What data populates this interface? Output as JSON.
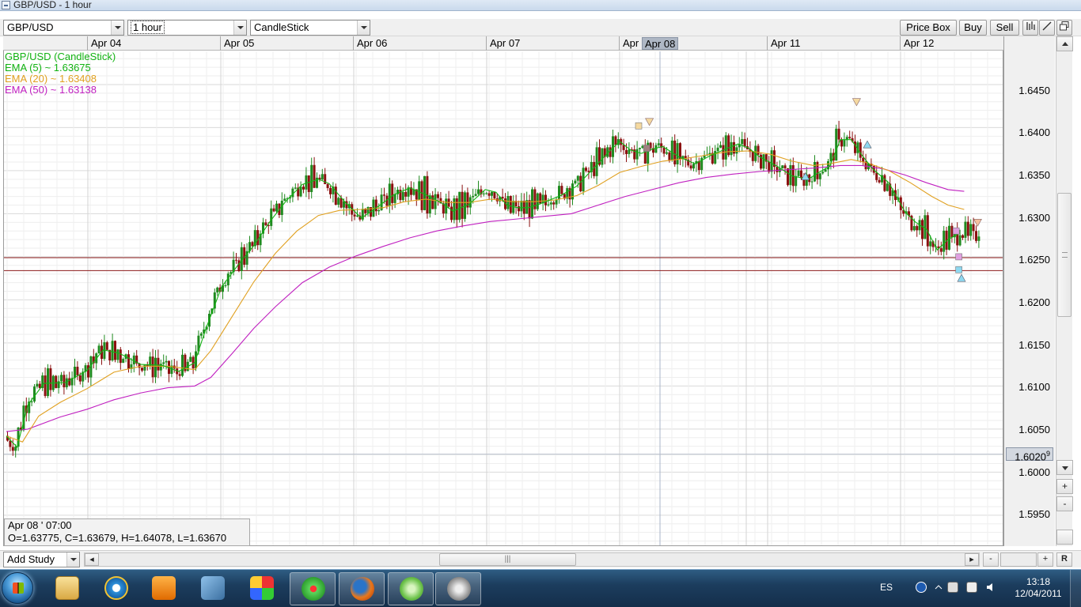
{
  "window": {
    "title": "GBP/USD - 1 hour"
  },
  "toolbar": {
    "symbol": "GBP/USD",
    "timeframe": "1 hour",
    "chart_type": "CandleStick",
    "buttons": {
      "price_box": "Price Box",
      "buy": "Buy",
      "sell": "Sell"
    }
  },
  "legend": {
    "main": "GBP/USD (CandleStick)",
    "ema5": "EMA (5) ~ 1.63675",
    "ema20": "EMA (20) ~ 1.63408",
    "ema50": "EMA (50) ~ 1.63138"
  },
  "x_axis": {
    "labels": [
      "Apr 04",
      "Apr 05",
      "Apr 06",
      "Apr 07",
      "Apr",
      "Apr 11",
      "Apr 12"
    ],
    "cursor_label": "Apr 08"
  },
  "y_axis": {
    "labels": [
      "1.6450",
      "1.6400",
      "1.6350",
      "1.6300",
      "1.6250",
      "1.6200",
      "1.6150",
      "1.6100",
      "1.6050",
      "1.6000",
      "1.5950"
    ],
    "cursor_value": "1.6020",
    "cursor_superscript": "9"
  },
  "info_box": {
    "line1": "Apr 08 ' 07:00",
    "line2": "O=1.63775, C=1.63679, H=1.64078, L=1.63670"
  },
  "bottom": {
    "add_study": "Add Study",
    "r_label": "R",
    "plus": "+",
    "minus": "-"
  },
  "tray": {
    "language": "ES",
    "time": "13:18",
    "date": "12/04/2011"
  },
  "colors": {
    "up_candle": "#1f8a1f",
    "down_candle": "#8b1010",
    "ema5": "#13b313",
    "ema20": "#e0a020",
    "ema50": "#c020c0",
    "support_lines": "#8b1a1a"
  },
  "chart_data": {
    "type": "candlestick",
    "symbol": "GBP/USD",
    "interval": "1 hour",
    "sessions": [
      "Apr 04",
      "Apr 05",
      "Apr 06",
      "Apr 07",
      "Apr 08",
      "Apr 11",
      "Apr 12"
    ],
    "horizontal_lines": [
      1.6249,
      1.6234
    ],
    "ylim": [
      1.5915,
      1.6505
    ],
    "ema5_path": [
      [
        0,
        1.6042
      ],
      [
        4,
        1.6029
      ],
      [
        8,
        1.6078
      ],
      [
        14,
        1.6103
      ],
      [
        22,
        1.6104
      ],
      [
        30,
        1.6118
      ],
      [
        36,
        1.6142
      ],
      [
        42,
        1.6138
      ],
      [
        50,
        1.6125
      ],
      [
        58,
        1.6124
      ],
      [
        64,
        1.6117
      ],
      [
        70,
        1.6127
      ],
      [
        74,
        1.6165
      ],
      [
        80,
        1.6215
      ],
      [
        86,
        1.624
      ],
      [
        92,
        1.6263
      ],
      [
        98,
        1.6291
      ],
      [
        104,
        1.6315
      ],
      [
        110,
        1.6334
      ],
      [
        116,
        1.634
      ],
      [
        120,
        1.6335
      ],
      [
        126,
        1.6313
      ],
      [
        132,
        1.6295
      ],
      [
        138,
        1.6308
      ],
      [
        144,
        1.6322
      ],
      [
        150,
        1.633
      ],
      [
        156,
        1.6322
      ],
      [
        162,
        1.6312
      ],
      [
        166,
        1.6303
      ],
      [
        172,
        1.6311
      ],
      [
        178,
        1.6328
      ],
      [
        182,
        1.6325
      ],
      [
        186,
        1.631
      ],
      [
        190,
        1.6307
      ],
      [
        194,
        1.6307
      ],
      [
        198,
        1.6311
      ],
      [
        202,
        1.6316
      ],
      [
        206,
        1.6321
      ],
      [
        212,
        1.6332
      ],
      [
        218,
        1.6352
      ],
      [
        224,
        1.6372
      ],
      [
        228,
        1.6384
      ],
      [
        232,
        1.6374
      ],
      [
        236,
        1.637
      ],
      [
        240,
        1.6375
      ],
      [
        244,
        1.6378
      ],
      [
        250,
        1.6366
      ],
      [
        256,
        1.6358
      ],
      [
        262,
        1.6368
      ],
      [
        268,
        1.6376
      ],
      [
        272,
        1.6381
      ],
      [
        276,
        1.6376
      ],
      [
        280,
        1.6366
      ],
      [
        286,
        1.6356
      ],
      [
        292,
        1.6344
      ],
      [
        298,
        1.634
      ],
      [
        302,
        1.6348
      ],
      [
        306,
        1.6355
      ],
      [
        310,
        1.6386
      ],
      [
        314,
        1.6386
      ],
      [
        318,
        1.6368
      ],
      [
        322,
        1.6352
      ],
      [
        328,
        1.6336
      ],
      [
        334,
        1.6302
      ],
      [
        338,
        1.629
      ],
      [
        342,
        1.6282
      ],
      [
        346,
        1.6258
      ],
      [
        350,
        1.627
      ],
      [
        354,
        1.6277
      ]
    ],
    "ema20_path": [
      [
        0,
        1.6042
      ],
      [
        6,
        1.6035
      ],
      [
        12,
        1.6065
      ],
      [
        20,
        1.6081
      ],
      [
        30,
        1.6097
      ],
      [
        40,
        1.6116
      ],
      [
        50,
        1.6123
      ],
      [
        60,
        1.6123
      ],
      [
        70,
        1.6119
      ],
      [
        76,
        1.6141
      ],
      [
        84,
        1.6181
      ],
      [
        92,
        1.6221
      ],
      [
        100,
        1.6254
      ],
      [
        108,
        1.628
      ],
      [
        116,
        1.6298
      ],
      [
        124,
        1.6304
      ],
      [
        132,
        1.6305
      ],
      [
        140,
        1.6307
      ],
      [
        148,
        1.6314
      ],
      [
        156,
        1.6317
      ],
      [
        164,
        1.6313
      ],
      [
        172,
        1.6313
      ],
      [
        180,
        1.6317
      ],
      [
        188,
        1.6314
      ],
      [
        196,
        1.6314
      ],
      [
        204,
        1.6316
      ],
      [
        212,
        1.6321
      ],
      [
        220,
        1.6333
      ],
      [
        228,
        1.6348
      ],
      [
        236,
        1.6355
      ],
      [
        244,
        1.6361
      ],
      [
        252,
        1.6364
      ],
      [
        260,
        1.6368
      ],
      [
        268,
        1.6372
      ],
      [
        276,
        1.6373
      ],
      [
        284,
        1.6369
      ],
      [
        292,
        1.6361
      ],
      [
        300,
        1.6356
      ],
      [
        306,
        1.6358
      ],
      [
        314,
        1.6363
      ],
      [
        320,
        1.6359
      ],
      [
        328,
        1.635
      ],
      [
        336,
        1.6336
      ],
      [
        344,
        1.632
      ],
      [
        350,
        1.631
      ],
      [
        356,
        1.6305
      ]
    ],
    "ema50_path": [
      [
        0,
        1.6047
      ],
      [
        8,
        1.605
      ],
      [
        20,
        1.6064
      ],
      [
        30,
        1.6073
      ],
      [
        40,
        1.6084
      ],
      [
        50,
        1.6092
      ],
      [
        60,
        1.6098
      ],
      [
        70,
        1.61
      ],
      [
        76,
        1.611
      ],
      [
        84,
        1.6138
      ],
      [
        92,
        1.6167
      ],
      [
        100,
        1.6192
      ],
      [
        110,
        1.622
      ],
      [
        120,
        1.6238
      ],
      [
        130,
        1.6251
      ],
      [
        140,
        1.6262
      ],
      [
        150,
        1.6272
      ],
      [
        160,
        1.628
      ],
      [
        170,
        1.6286
      ],
      [
        180,
        1.6291
      ],
      [
        190,
        1.6294
      ],
      [
        200,
        1.6297
      ],
      [
        210,
        1.63
      ],
      [
        220,
        1.631
      ],
      [
        230,
        1.632
      ],
      [
        240,
        1.6328
      ],
      [
        250,
        1.6336
      ],
      [
        260,
        1.6342
      ],
      [
        270,
        1.6346
      ],
      [
        280,
        1.6349
      ],
      [
        290,
        1.6351
      ],
      [
        300,
        1.6353
      ],
      [
        310,
        1.6356
      ],
      [
        318,
        1.6356
      ],
      [
        326,
        1.6352
      ],
      [
        334,
        1.6345
      ],
      [
        342,
        1.6336
      ],
      [
        350,
        1.6328
      ],
      [
        356,
        1.6326
      ]
    ],
    "candles_sample": [
      {
        "t": 0,
        "o": 1.6045,
        "h": 1.6049,
        "l": 1.603,
        "c": 1.604
      },
      {
        "t": 6,
        "o": 1.6011,
        "h": 1.603,
        "l": 1.5973,
        "c": 1.598
      },
      {
        "t": 10,
        "o": 1.605,
        "h": 1.6132,
        "l": 1.6045,
        "c": 1.6128
      },
      {
        "t": 80,
        "o": 1.615,
        "h": 1.6245,
        "l": 1.6105,
        "c": 1.624
      },
      {
        "t": 125,
        "o": 1.6345,
        "h": 1.636,
        "l": 1.632,
        "c": 1.633
      },
      {
        "t": 224,
        "o": 1.63775,
        "h": 1.64078,
        "l": 1.6367,
        "c": 1.63679
      },
      {
        "t": 312,
        "o": 1.6412,
        "h": 1.6417,
        "l": 1.638,
        "c": 1.6385
      },
      {
        "t": 352,
        "o": 1.6257,
        "h": 1.6275,
        "l": 1.6248,
        "c": 1.6268
      }
    ]
  }
}
